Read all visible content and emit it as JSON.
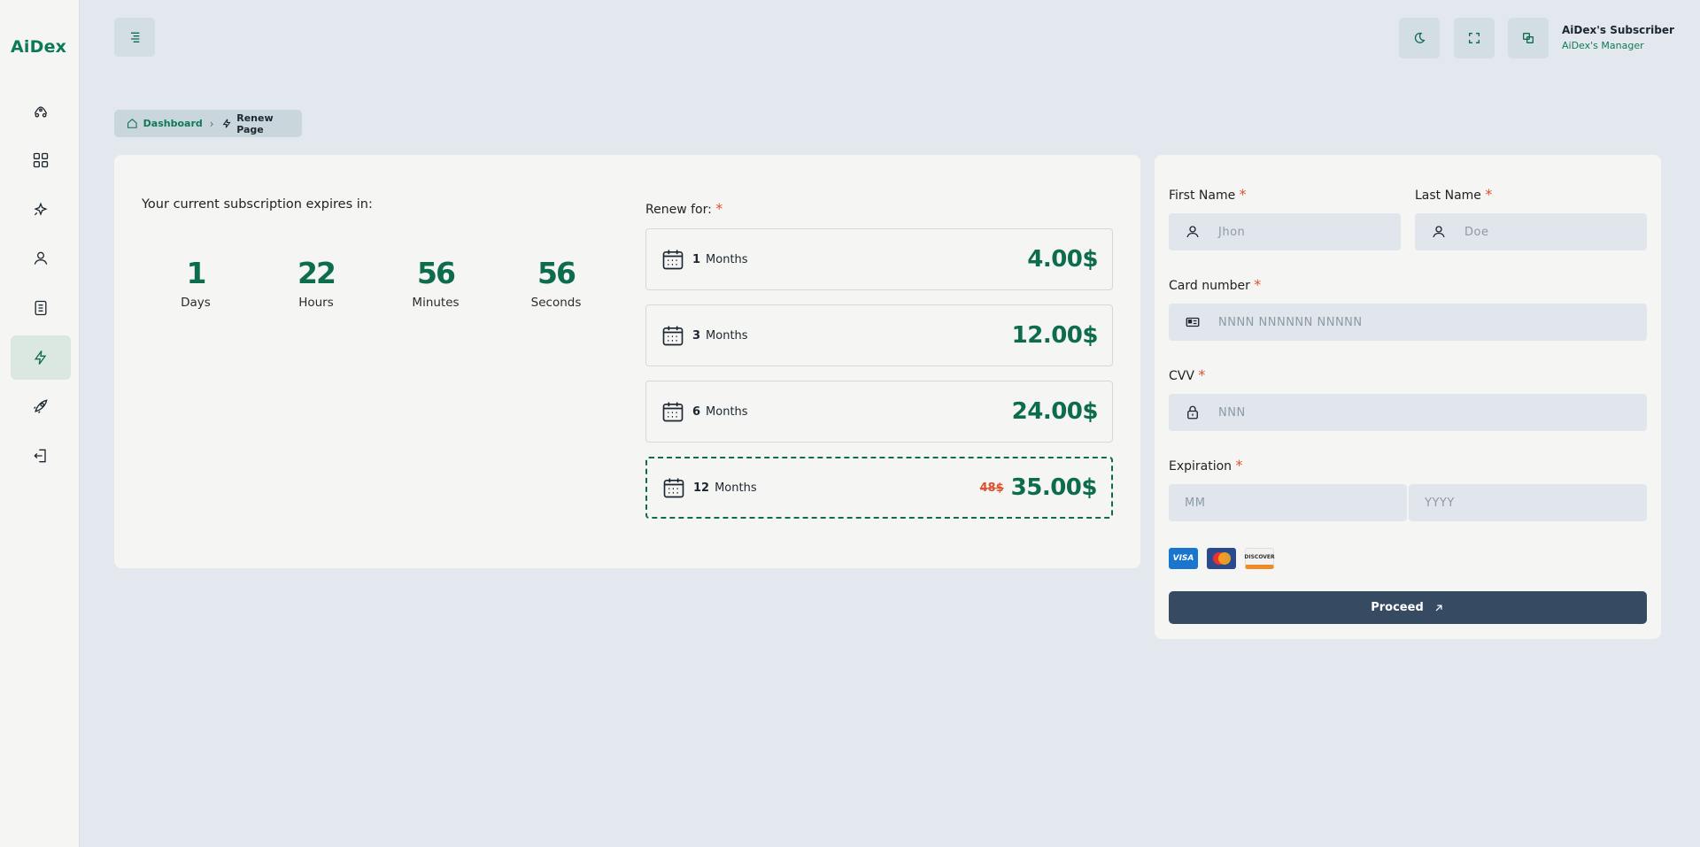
{
  "app": {
    "logo_text": "AiDex"
  },
  "colors": {
    "accent": "#0d6b4e",
    "danger": "#e0502c",
    "button": "#364b62"
  },
  "sidebar": {
    "items": [
      {
        "icon": "rocket-icon",
        "active": false
      },
      {
        "icon": "grid-icon",
        "active": false
      },
      {
        "icon": "sparkles-icon",
        "active": false
      },
      {
        "icon": "user-icon",
        "active": false
      },
      {
        "icon": "document-icon",
        "active": false
      },
      {
        "icon": "lightning-icon",
        "active": true
      },
      {
        "icon": "rocket-badge-icon",
        "active": false
      },
      {
        "icon": "logout-icon",
        "active": false
      }
    ]
  },
  "header": {
    "user_name": "AiDex's Subscriber",
    "user_role": "AiDex's Manager"
  },
  "breadcrumb": {
    "home": "Dashboard",
    "current": "Renew Page"
  },
  "countdown": {
    "title": "Your current subscription expires in:",
    "items": [
      {
        "value": "1",
        "label": "Days"
      },
      {
        "value": "22",
        "label": "Hours"
      },
      {
        "value": "56",
        "label": "Minutes"
      },
      {
        "value": "56",
        "label": "Seconds"
      }
    ]
  },
  "renew": {
    "title": "Renew for:",
    "required_mark": "*",
    "plans": [
      {
        "num": "1",
        "unit": "Months",
        "price": "4.00$",
        "old_price": "",
        "selected": false
      },
      {
        "num": "3",
        "unit": "Months",
        "price": "12.00$",
        "old_price": "",
        "selected": false
      },
      {
        "num": "6",
        "unit": "Months",
        "price": "24.00$",
        "old_price": "",
        "selected": false
      },
      {
        "num": "12",
        "unit": "Months",
        "price": "35.00$",
        "old_price": "48$",
        "selected": true
      }
    ]
  },
  "form": {
    "first_name_label": "First Name",
    "first_name_placeholder": "Jhon",
    "last_name_label": "Last Name",
    "last_name_placeholder": "Doe",
    "card_number_label": "Card number",
    "card_number_placeholder": "NNNN NNNNNN NNNNN",
    "cvv_label": "CVV",
    "cvv_placeholder": "NNN",
    "expiration_label": "Expiration",
    "month_placeholder": "MM",
    "year_placeholder": "YYYY",
    "required_mark": "*",
    "payment_cards": [
      "VISA",
      "MasterCard",
      "DISCOVER"
    ],
    "proceed_label": "Proceed"
  }
}
